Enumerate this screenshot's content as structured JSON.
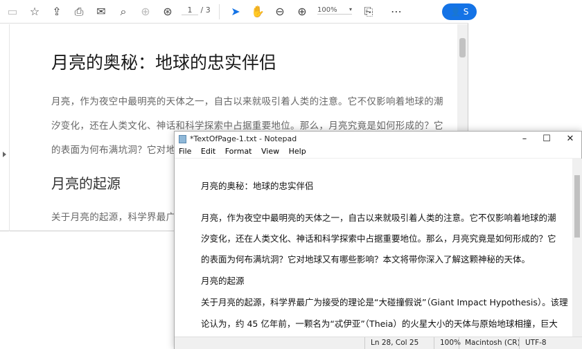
{
  "pdf_viewer": {
    "toolbar": {
      "icons": [
        "save-icon",
        "star-icon",
        "upload-icon",
        "print-icon",
        "mail-icon",
        "search-icon",
        "page-up-icon",
        "page-down-icon",
        "select-arrow-icon",
        "hand-icon",
        "zoom-out-icon",
        "zoom-in-icon",
        "page-fit-icon",
        "more-icon"
      ],
      "page_current": "1",
      "page_total": "/ 3",
      "zoom": "100%",
      "share_label": "S",
      "accent": "#1473e6"
    },
    "document": {
      "title": "月亮的奥秘：地球的忠实伴侣",
      "paragraph_lines": [
        "月亮，作为夜空中最明亮的天体之一，自古以来就吸引着人类的注意。它不仅影响着地球的潮",
        "汐变化，还在人类文化、神话和科学探索中占据重要地位。那么，月亮究竟是如何形成的？它",
        "的表面为何布满坑洞？它对地"
      ],
      "heading": "月亮的起源",
      "paragraph2": "关于月亮的起源，科学界最广"
    }
  },
  "notepad": {
    "title": "*TextOfPage-1.txt - Notepad",
    "menu": [
      "File",
      "Edit",
      "Format",
      "View",
      "Help"
    ],
    "lines": [
      "月亮的奥秘：地球的忠实伴侣",
      "月亮，作为夜空中最明亮的天体之一，自古以来就吸引着人类的注意。它不仅影响着地球的潮",
      "汐变化，还在人类文化、神话和科学探索中占据重要地位。那么，月亮究竟是如何形成的？它",
      "的表面为何布满坑洞？它对地球又有哪些影响？本文将带你深入了解这颗神秘的天体。",
      "月亮的起源",
      "关于月亮的起源，科学界最广为接受的理论是“大碰撞假说”（Giant Impact Hypothesis）。该理",
      "论认为，约 45 亿年前，一颗名为“忒伊亚”（Theia）的火星大小的天体与原始地球相撞，巨大"
    ],
    "status": {
      "position": "Ln 28, Col 25",
      "zoom": "100%",
      "line_ending": "Macintosh (CR)",
      "encoding": "UTF-8"
    }
  }
}
